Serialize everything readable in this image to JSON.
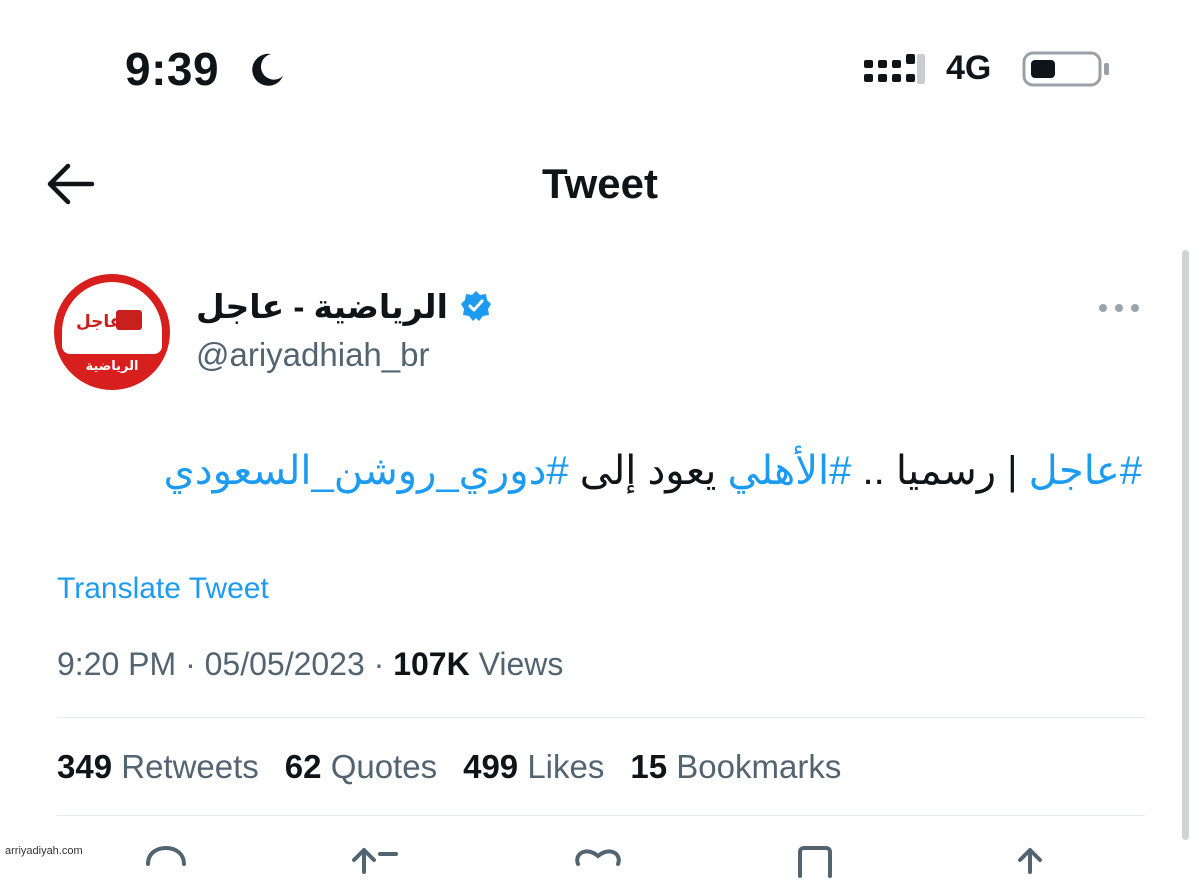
{
  "status_bar": {
    "time": "9:39",
    "network": "4G"
  },
  "header": {
    "title": "Tweet"
  },
  "author": {
    "display_name": "الرياضية - عاجل",
    "handle": "@ariyadhiah_br",
    "avatar_text_top": "عاجل",
    "avatar_text_bottom": "الرياضية"
  },
  "tweet": {
    "segments": [
      {
        "text": "#عاجل",
        "hashtag": true
      },
      {
        "text": " | رسميا .. ",
        "hashtag": false
      },
      {
        "text": "#الأهلي",
        "hashtag": true
      },
      {
        "text": " يعود إلى ",
        "hashtag": false
      },
      {
        "text": "#دوري_روشن_السعودي",
        "hashtag": true
      }
    ],
    "translate_label": "Translate Tweet"
  },
  "meta": {
    "time": "9:20 PM",
    "separator": " · ",
    "date": "05/05/2023",
    "views_count": "107K",
    "views_label": "Views"
  },
  "stats": [
    {
      "count": "349",
      "label": "Retweets"
    },
    {
      "count": "62",
      "label": "Quotes"
    },
    {
      "count": "499",
      "label": "Likes"
    },
    {
      "count": "15",
      "label": "Bookmarks"
    }
  ],
  "actions": [
    "reply-icon",
    "retweet-icon",
    "like-icon",
    "bookmark-icon",
    "share-icon"
  ],
  "watermark": "arriyadiyah.com",
  "colors": {
    "link": "#1d9bf0",
    "verified": "#1d9bf0",
    "avatar_red": "#d7201d",
    "secondary_text": "#536471"
  }
}
